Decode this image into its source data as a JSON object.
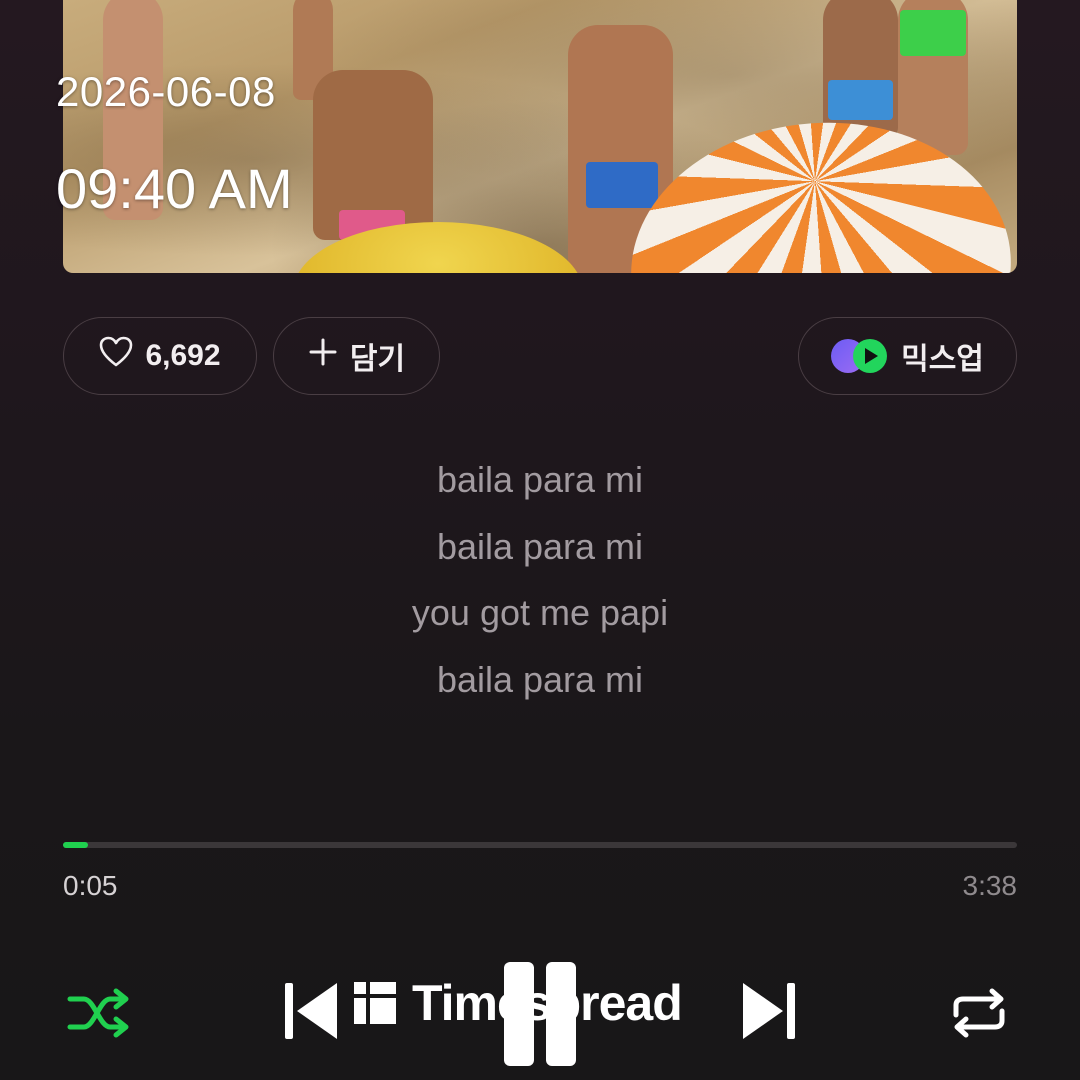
{
  "overlay": {
    "date": "2026-06-08",
    "time": "09:40 AM"
  },
  "album_art": {
    "subject_icon": "beach-photo"
  },
  "actions": {
    "like": {
      "icon": "heart-outline-icon",
      "count": "6,692"
    },
    "add": {
      "icon": "plus-icon",
      "label": "담기"
    },
    "mixup": {
      "icon": "mixup-logo-icon",
      "label": "믹스업"
    }
  },
  "lyrics": [
    "baila para mi",
    "baila para mi",
    "you got me papi",
    "baila para mi"
  ],
  "player": {
    "progress_fraction": 0.026,
    "elapsed": "0:05",
    "total": "3:38",
    "accent": "#20d04f",
    "controls": [
      "shuffle-icon",
      "previous-icon",
      "pause-icon",
      "next-icon",
      "repeat-icon"
    ]
  },
  "watermark": {
    "text": "Timespread"
  }
}
